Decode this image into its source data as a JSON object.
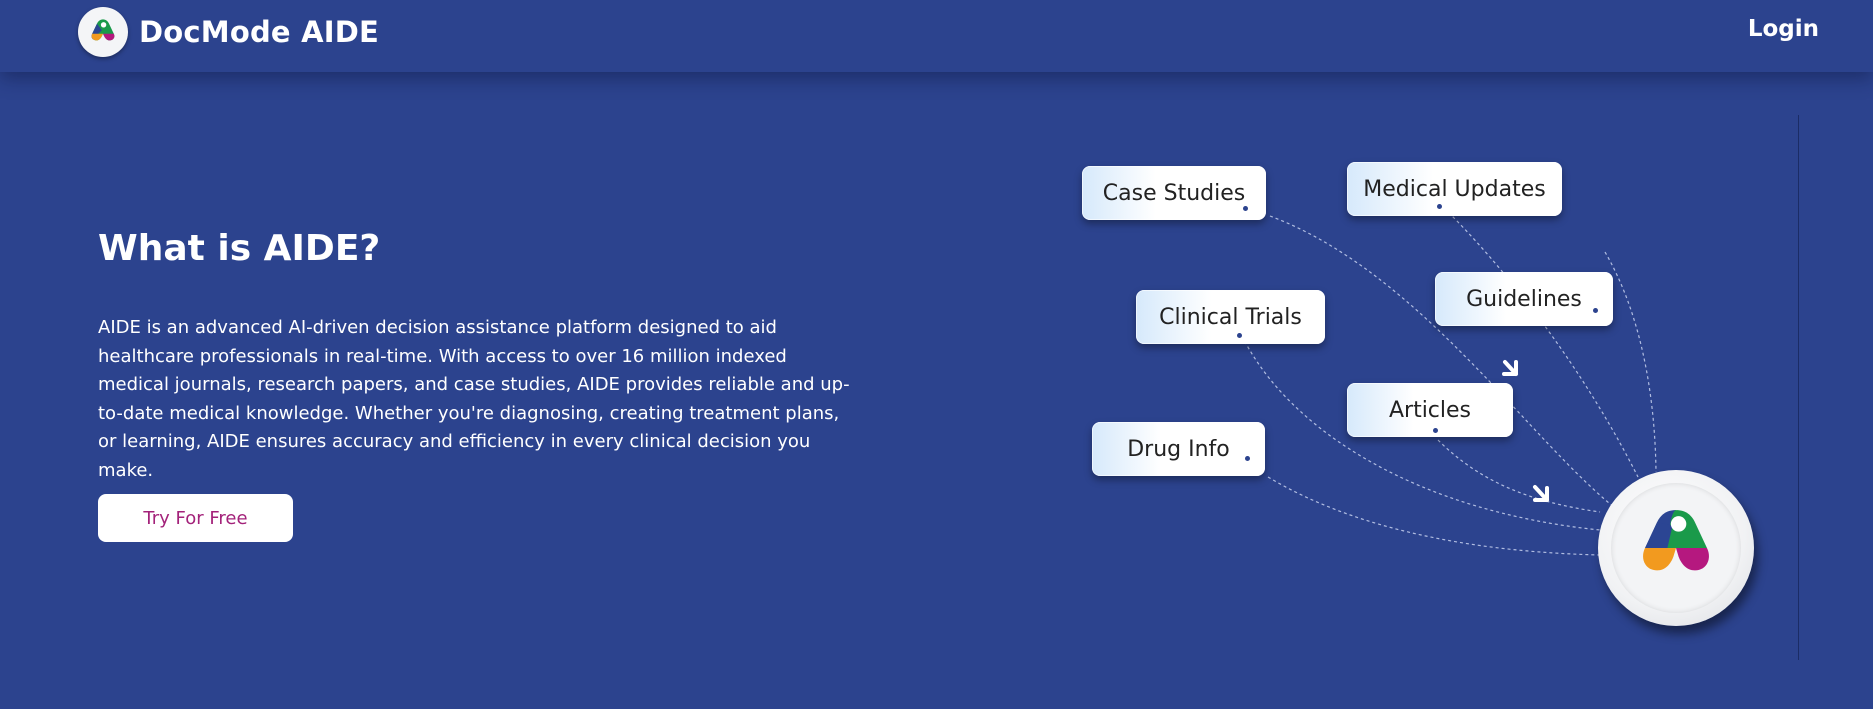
{
  "navbar": {
    "brand_name": "DocMode AIDE",
    "brand_logo_icon": "aide-logo-icon",
    "login_label": "Login"
  },
  "hero": {
    "title": "What is AIDE?",
    "description": "AIDE is an advanced AI-driven decision assistance platform designed to aid healthcare professionals in real-time. With access to over 16 million indexed medical journals, research papers, and case studies, AIDE provides reliable and up-to-date medical knowledge. Whether you're diagnosing, creating treatment plans, or learning, AIDE ensures accuracy and efficiency in every clinical decision you make.",
    "cta_label": "Try For Free"
  },
  "illustration": {
    "chips": [
      {
        "label": "Case Studies"
      },
      {
        "label": "Medical Updates"
      },
      {
        "label": "Clinical Trials"
      },
      {
        "label": "Guidelines"
      },
      {
        "label": "Articles"
      },
      {
        "label": "Drug Info"
      }
    ],
    "center_icon": "aide-logo-icon",
    "arrow_icon": "arrow-icon"
  },
  "colors": {
    "background": "#2c438e",
    "cta_text": "#a3227a",
    "logo_green": "#1a9a4a",
    "logo_blue": "#2b4593",
    "logo_orange": "#f29a1f",
    "logo_magenta": "#b5187f"
  }
}
